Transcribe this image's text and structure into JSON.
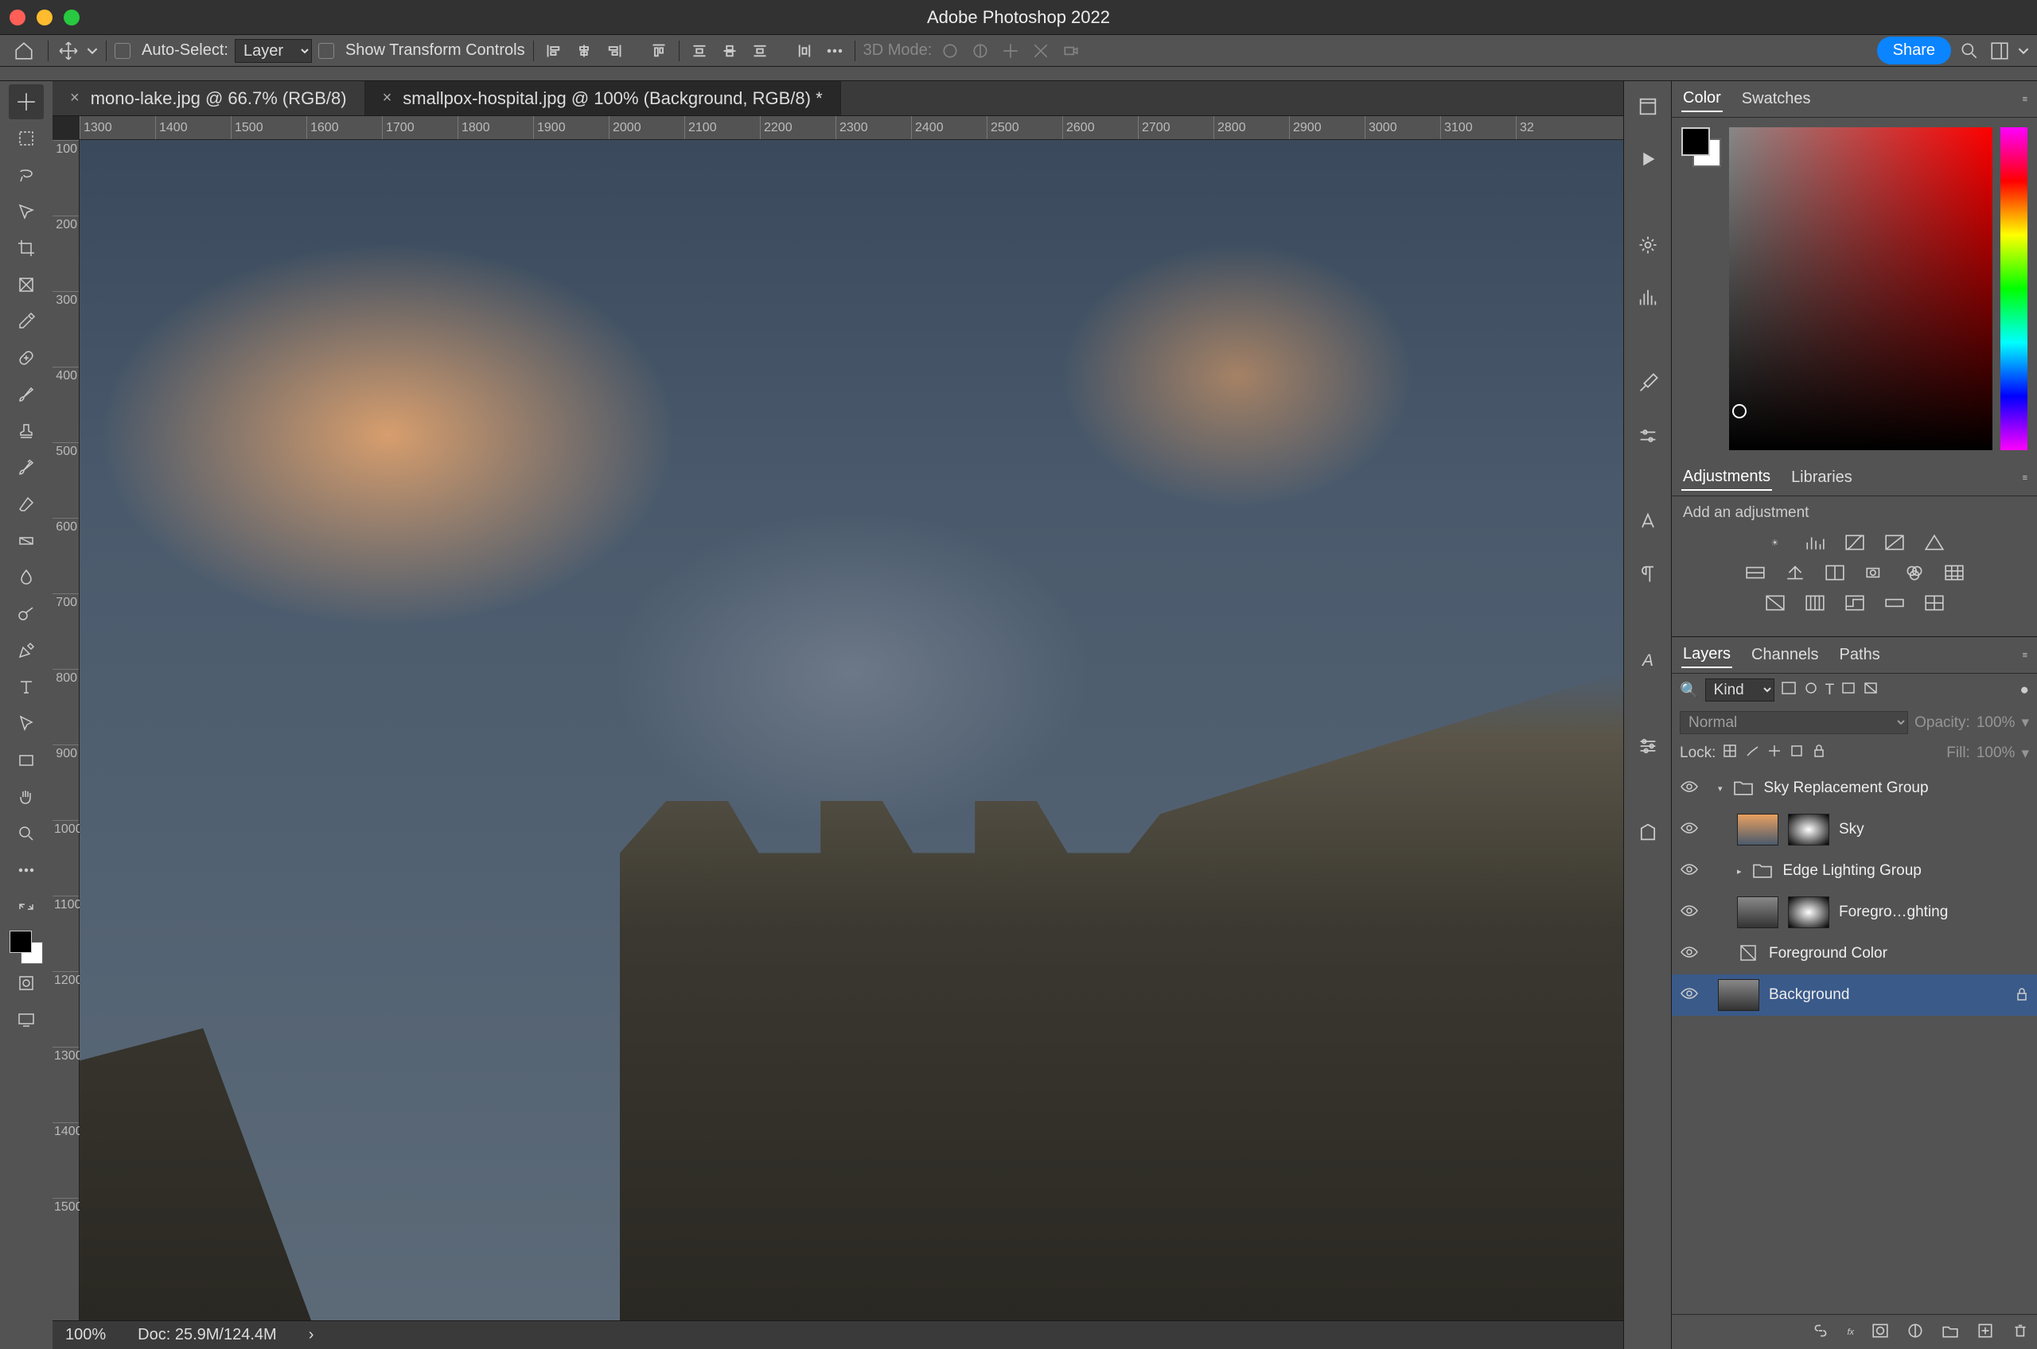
{
  "titlebar": {
    "title": "Adobe Photoshop 2022"
  },
  "options": {
    "auto_select_label": "Auto-Select:",
    "auto_select_value": "Layer",
    "show_transform_label": "Show Transform Controls",
    "mode3d_label": "3D Mode:",
    "share_label": "Share"
  },
  "tabs": [
    {
      "label": "mono-lake.jpg @ 66.7% (RGB/8)",
      "active": false
    },
    {
      "label": "smallpox-hospital.jpg @ 100% (Background, RGB/8) *",
      "active": true
    }
  ],
  "ruler_h": [
    "1300",
    "1400",
    "1500",
    "1600",
    "1700",
    "1800",
    "1900",
    "2000",
    "2100",
    "2200",
    "2300",
    "2400",
    "2500",
    "2600",
    "2700",
    "2800",
    "2900",
    "3000",
    "3100",
    "32"
  ],
  "ruler_v": [
    "100",
    "200",
    "300",
    "400",
    "500",
    "600",
    "700",
    "800",
    "900",
    "1000",
    "1100",
    "1200",
    "1300",
    "1400",
    "1500"
  ],
  "status": {
    "zoom": "100%",
    "doc": "Doc: 25.9M/124.4M"
  },
  "color_panel": {
    "tabs": [
      "Color",
      "Swatches"
    ],
    "active": "Color"
  },
  "adjustments_panel": {
    "tabs": [
      "Adjustments",
      "Libraries"
    ],
    "active": "Adjustments",
    "hint": "Add an adjustment"
  },
  "layers_panel": {
    "tabs": [
      "Layers",
      "Channels",
      "Paths"
    ],
    "active": "Layers",
    "filter_label": "Kind",
    "blend_mode": "Normal",
    "opacity_label": "Opacity:",
    "opacity_value": "100%",
    "lock_label": "Lock:",
    "fill_label": "Fill:",
    "fill_value": "100%",
    "layers": [
      {
        "name": "Sky Replacement Group",
        "kind": "group",
        "indent": 0,
        "open": true
      },
      {
        "name": "Sky",
        "kind": "layer",
        "indent": 1,
        "thumb": "sky",
        "mask": true
      },
      {
        "name": "Edge Lighting Group",
        "kind": "group",
        "indent": 1,
        "open": false
      },
      {
        "name": "Foregro…ghting",
        "kind": "layer",
        "indent": 1,
        "thumb": "grey",
        "mask": true
      },
      {
        "name": "Foreground Color",
        "kind": "adjust",
        "indent": 1
      },
      {
        "name": "Background",
        "kind": "bg",
        "indent": 0,
        "locked": true
      }
    ]
  }
}
